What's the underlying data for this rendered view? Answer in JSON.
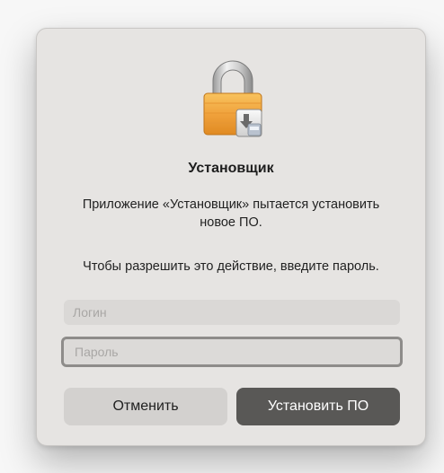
{
  "dialog": {
    "title": "Установщик",
    "message": "Приложение «Установщик» пытается установить новое ПО.",
    "prompt": "Чтобы разрешить это действие, введите пароль.",
    "icon": "lock-installer-icon"
  },
  "form": {
    "login_placeholder": "Логин",
    "login_value": "",
    "password_placeholder": "Пароль",
    "password_value": ""
  },
  "buttons": {
    "cancel_label": "Отменить",
    "install_label": "Установить ПО"
  },
  "colors": {
    "dialog_bg": "#e6e4e2",
    "primary_button": "#595856",
    "secondary_button": "#d3d1cf",
    "lock_body": "#f0a23c"
  }
}
